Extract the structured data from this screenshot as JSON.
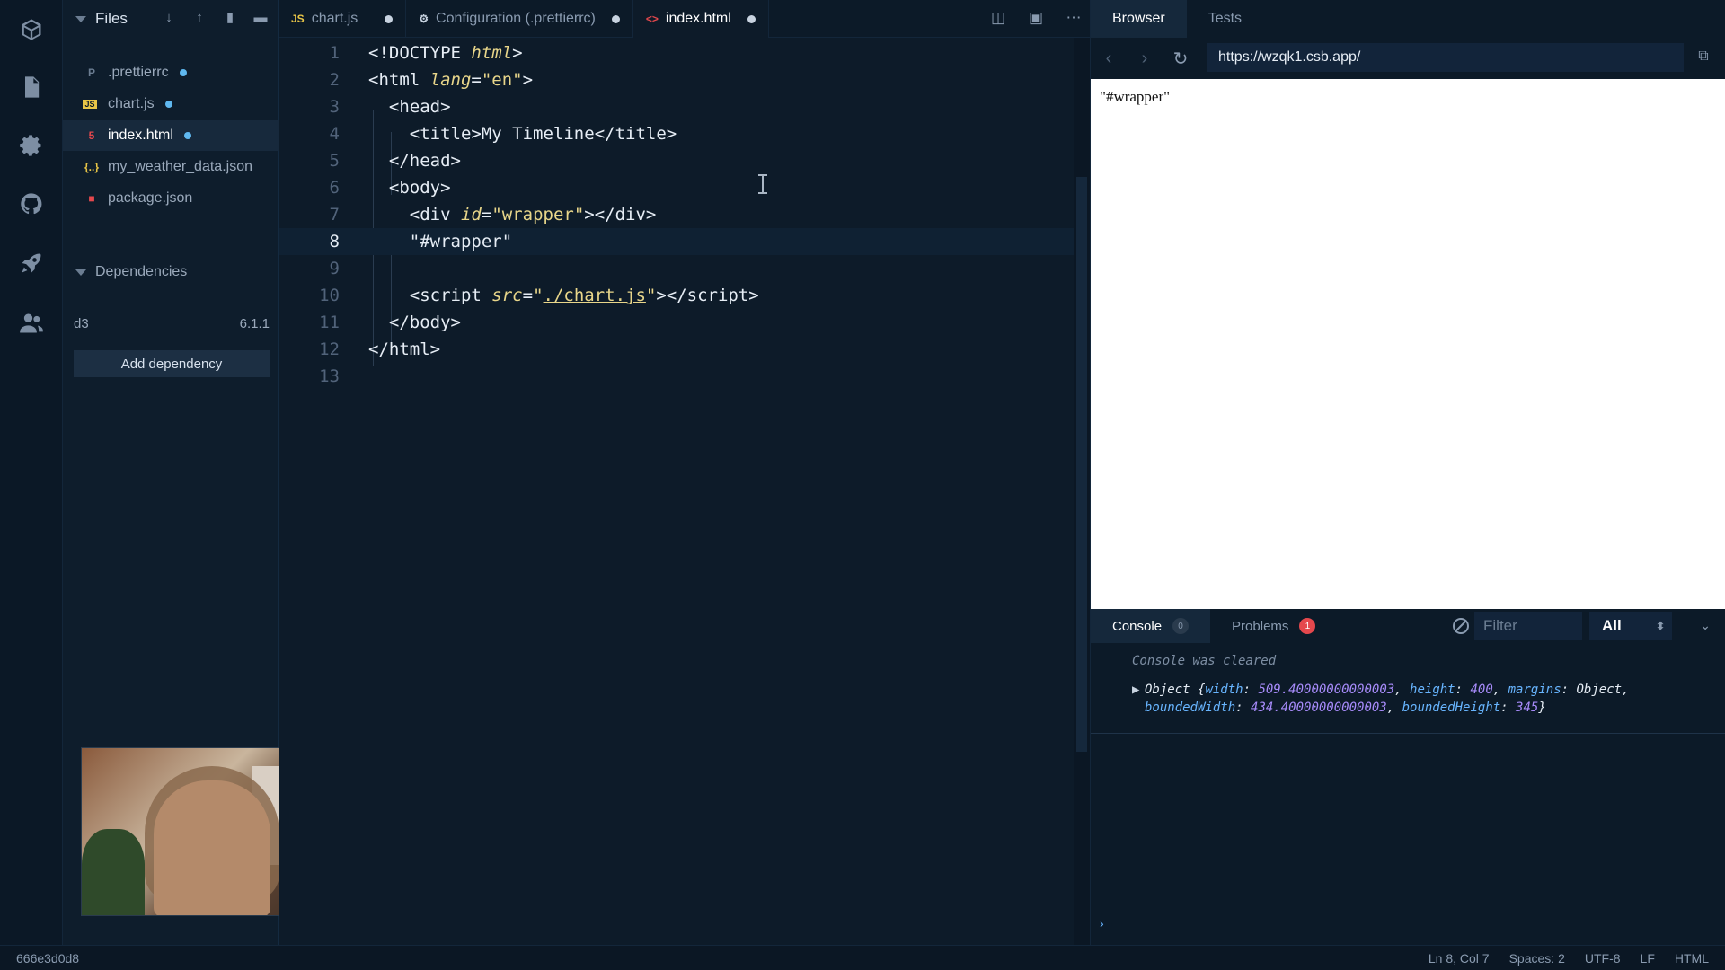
{
  "sidebar": {
    "title": "Files",
    "files": [
      {
        "icon": "P",
        "name": ".prettierrc",
        "modified": true,
        "active": false,
        "color": "#6b7d92"
      },
      {
        "icon": "JS",
        "name": "chart.js",
        "modified": true,
        "active": false,
        "color": "#e8c547"
      },
      {
        "icon": "5",
        "name": "index.html",
        "modified": true,
        "active": true,
        "color": "#e5484d"
      },
      {
        "icon": "{..}",
        "name": "my_weather_data.json",
        "modified": false,
        "active": false,
        "color": "#e8c547"
      },
      {
        "icon": "■",
        "name": "package.json",
        "modified": false,
        "active": false,
        "color": "#e5484d"
      }
    ],
    "dependencies_title": "Dependencies",
    "dependency": {
      "name": "d3",
      "version": "6.1.1"
    },
    "add_dependency": "Add dependency"
  },
  "tabs": [
    {
      "icon": "JS",
      "label": "chart.js",
      "active": false
    },
    {
      "icon": "⚙",
      "label": "Configuration (.prettierrc)",
      "active": false
    },
    {
      "icon": "<>",
      "label": "index.html",
      "active": true
    }
  ],
  "editor": {
    "current_line": 8,
    "lines": [
      {
        "n": "1",
        "html": "<span class=\"t\">&lt;!DOCTYPE </span><span class=\"a\">html</span><span class=\"t\">&gt;</span>"
      },
      {
        "n": "2",
        "html": "<span class=\"t\">&lt;html </span><span class=\"a\">lang</span><span class=\"t\">=</span><span class=\"s\">\"en\"</span><span class=\"t\">&gt;</span>"
      },
      {
        "n": "3",
        "html": "  <span class=\"t\">&lt;head&gt;</span>"
      },
      {
        "n": "4",
        "html": "    <span class=\"t\">&lt;title&gt;</span><span class=\"l\">My Timeline</span><span class=\"t\">&lt;/title&gt;</span>"
      },
      {
        "n": "5",
        "html": "  <span class=\"t\">&lt;/head&gt;</span>"
      },
      {
        "n": "6",
        "html": "  <span class=\"t\">&lt;body&gt;</span>"
      },
      {
        "n": "7",
        "html": "    <span class=\"t\">&lt;div </span><span class=\"a\">id</span><span class=\"t\">=</span><span class=\"s\">\"wrapper\"</span><span class=\"t\">&gt;&lt;/div&gt;</span>"
      },
      {
        "n": "8",
        "html": "    <span class=\"l\">\"#wrapper\"</span>"
      },
      {
        "n": "9",
        "html": ""
      },
      {
        "n": "10",
        "html": "    <span class=\"t\">&lt;script </span><span class=\"a\">src</span><span class=\"t\">=</span><span class=\"s\">\"</span><span class=\"u\">./chart.js</span><span class=\"s\">\"</span><span class=\"t\">&gt;&lt;/script&gt;</span>"
      },
      {
        "n": "11",
        "html": "  <span class=\"t\">&lt;/body&gt;</span>"
      },
      {
        "n": "12",
        "html": "<span class=\"t\">&lt;/html&gt;</span>"
      },
      {
        "n": "13",
        "html": ""
      }
    ]
  },
  "browser": {
    "tab_browser": "Browser",
    "tab_tests": "Tests",
    "url": "https://wzqk1.csb.app/",
    "preview_text": "\"#wrapper\""
  },
  "console": {
    "tab_console": "Console",
    "console_count": "0",
    "tab_problems": "Problems",
    "problems_count": "1",
    "filter_placeholder": "Filter",
    "level": "All",
    "cleared_msg": "Console was cleared",
    "object_prefix": "Object {",
    "object_fields": [
      {
        "key": "width",
        "value": "509.40000000000003"
      },
      {
        "key": "height",
        "value": "400"
      },
      {
        "key": "margins",
        "value": "Object"
      },
      {
        "key": "boundedWidth",
        "value": "434.40000000000003"
      },
      {
        "key": "boundedHeight",
        "value": "345"
      }
    ],
    "object_suffix": "}"
  },
  "status": {
    "hash": "666e3d0d8",
    "position": "Ln 8, Col 7",
    "spaces": "Spaces: 2",
    "encoding": "UTF-8",
    "eol": "LF",
    "language": "HTML"
  }
}
